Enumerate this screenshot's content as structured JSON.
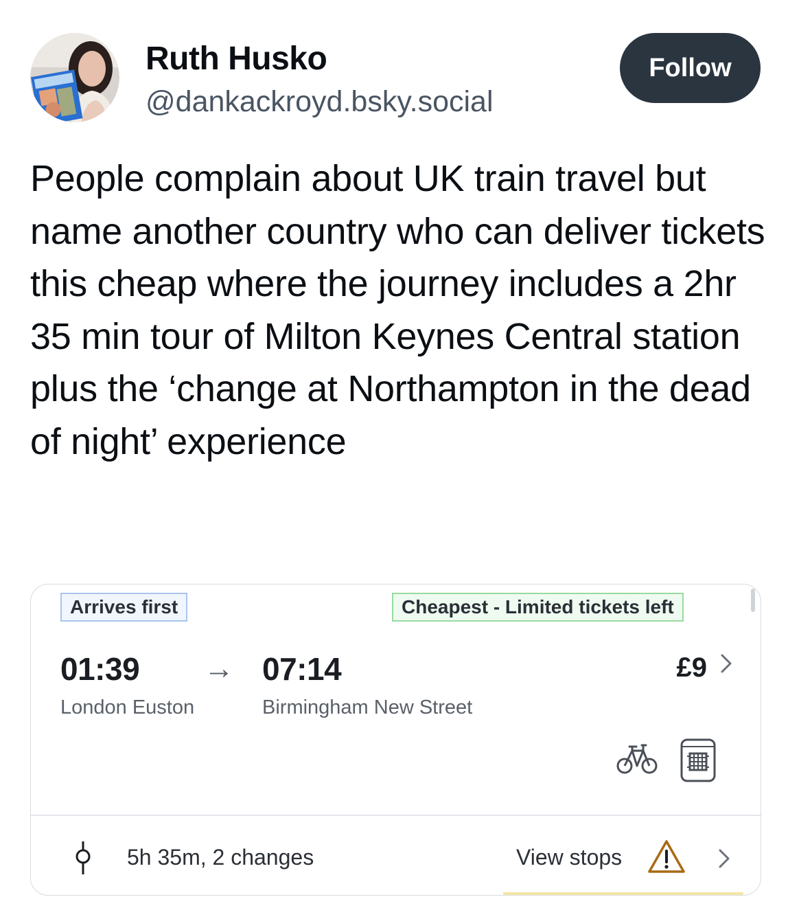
{
  "author": {
    "display_name": "Ruth Husko",
    "handle": "@dankackroyd.bsky.social",
    "avatar_icon": "profile-photo"
  },
  "follow_label": "Follow",
  "post": {
    "text": "People complain about UK train travel but name another country who can deliver tickets this cheap where the journey includes a 2hr 35 min tour of Milton Keynes Central station plus the ‘change at Northampton in the dead of night’ experience"
  },
  "journey": {
    "badge_arrives": "Arrives first",
    "badge_cheapest": "Cheapest - Limited tickets left",
    "depart_time": "01:39",
    "arrow": "→",
    "arrive_time": "07:14",
    "depart_station": "London Euston",
    "arrive_station": "Birmingham New Street",
    "price": "£9",
    "amenity_icons": [
      "bike-icon",
      "seat-reservation-icon"
    ],
    "summary": "5h 35m, 2 changes",
    "view_stops_label": "View stops",
    "warning_icon": "warning-icon",
    "colors": {
      "arrives_border": "#a9c4ee",
      "cheapest_border": "#97dba0",
      "follow_bg": "#2a3540",
      "warning": "#a86a12"
    }
  }
}
